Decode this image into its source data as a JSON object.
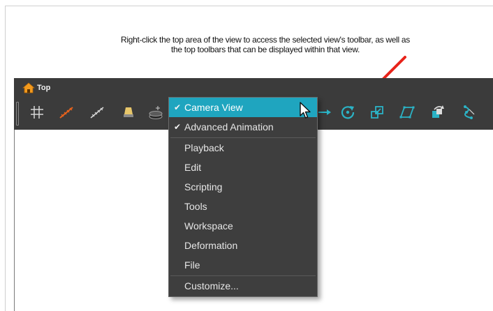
{
  "caption": {
    "line1": "Right-click the top area of the view to access the selected view's toolbar, as well as",
    "line2": "the top toolbars that can be displayed within that view."
  },
  "view": {
    "title": "Top"
  },
  "toolbar_icons": [
    "grid-icon",
    "onion-skin-icon",
    "light-table-icon",
    "lamp-icon",
    "layer-stack-icon",
    "translate-icon",
    "rotate-icon",
    "scale-icon",
    "skew-icon",
    "motion-icon",
    "deform-icon"
  ],
  "context_menu": {
    "items": [
      {
        "label": "Camera View",
        "checked": true,
        "highlighted": true
      },
      {
        "label": "Advanced Animation",
        "checked": true,
        "highlighted": false
      },
      {
        "label": "Playback",
        "checked": false
      },
      {
        "label": "Edit",
        "checked": false
      },
      {
        "label": "Scripting",
        "checked": false
      },
      {
        "label": "Tools",
        "checked": false
      },
      {
        "label": "Workspace",
        "checked": false
      },
      {
        "label": "Deformation",
        "checked": false
      },
      {
        "label": "File",
        "checked": false
      },
      {
        "label": "Customize...",
        "checked": false
      }
    ],
    "check_glyph": "✔"
  },
  "colors": {
    "highlight": "#1fa5bf",
    "annotation_arrow": "#e8231a",
    "toolbar_bg": "#3b3b3b",
    "icon_orange": "#e8621c",
    "icon_teal": "#2bb3c6"
  }
}
